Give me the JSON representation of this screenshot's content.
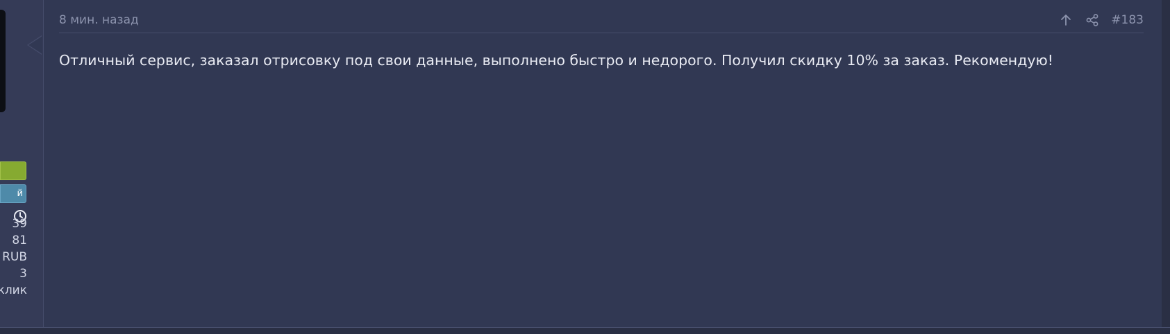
{
  "user": {
    "banner_primary": "",
    "banner_secondary": "й",
    "stats": [
      "39",
      "81",
      "RUB",
      "3",
      "клик"
    ]
  },
  "post": {
    "time": "8 мин. назад",
    "number": "#183",
    "text": "Отличный сервис, заказал отрисовку под свои данные, выполнено быстро и недорого. Получил скидку 10% за заказ. Рекомендую!"
  },
  "icons": {
    "up": "arrow-up-icon",
    "share": "share-icon",
    "clock": "clock-icon"
  },
  "colors": {
    "banner_green": "#86aa31",
    "banner_blue": "#4e8aa9",
    "post_bg": "#313853"
  }
}
